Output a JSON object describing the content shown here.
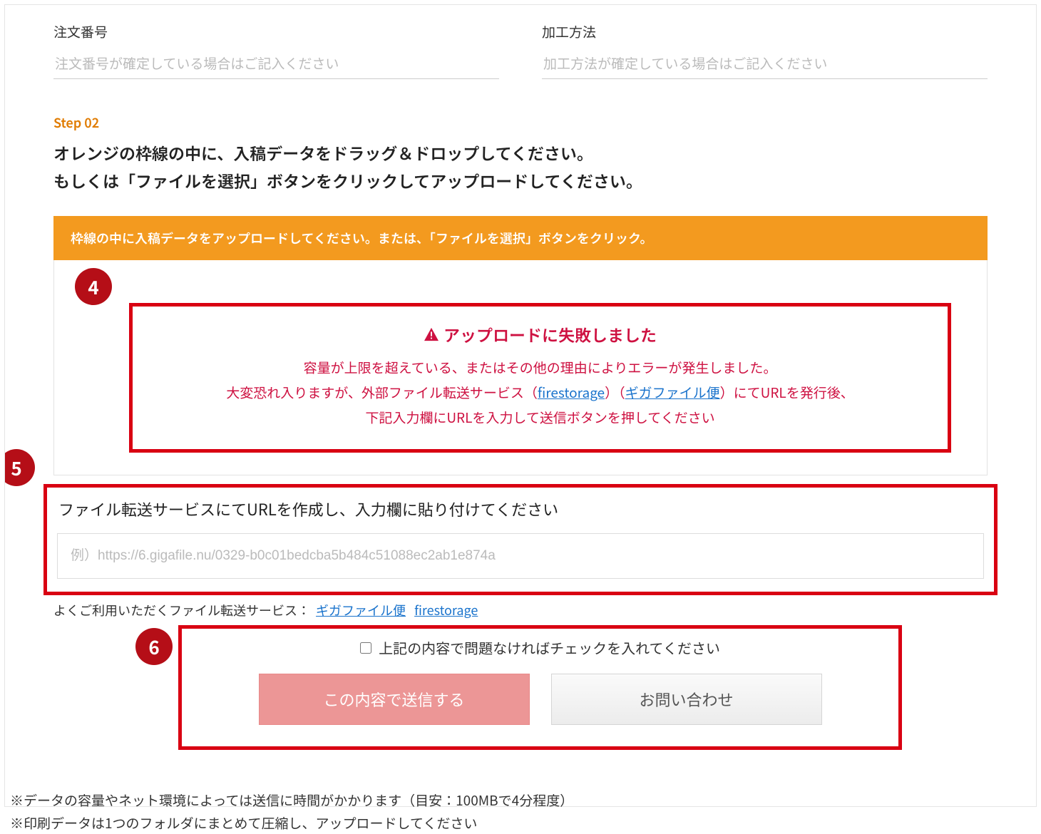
{
  "fields": {
    "order_number": {
      "label": "注文番号",
      "placeholder": "注文番号が確定している場合はご記入ください"
    },
    "process_method": {
      "label": "加工方法",
      "placeholder": "加工方法が確定している場合はご記入ください"
    }
  },
  "step02": {
    "label": "Step 02",
    "line1": "オレンジの枠線の中に、入稿データをドラッグ＆ドロップしてください。",
    "line2": "もしくは「ファイルを選択」ボタンをクリックしてアップロードしてください。"
  },
  "orange_bar": "枠線の中に入稿データをアップロードしてください。または、「ファイルを選択」ボタンをクリック。",
  "error": {
    "title": "アップロードに失敗しました",
    "line1": "容量が上限を超えている、またはその他の理由によりエラーが発生しました。",
    "line2_a": "大変恐れ入りますが、外部ファイル転送サービス（",
    "link1": "firestorage",
    "mid1": "）（",
    "link2": "ギガファイル便",
    "line2_b": "）にてURLを発行後、",
    "line3": "下記入力欄にURLを入力して送信ボタンを押してください"
  },
  "url_section": {
    "label": "ファイル転送サービスにてURLを作成し、入力欄に貼り付けてください",
    "placeholder": "例）https://6.gigafile.nu/0329-b0c01bedcba5b484c51088ec2ab1e874a"
  },
  "services": {
    "prefix": "よくご利用いただくファイル転送サービス：",
    "link1": "ギガファイル便",
    "link2": "firestorage"
  },
  "confirm": {
    "checkbox_label": "上記の内容で問題なければチェックを入れてください",
    "submit": "この内容で送信する",
    "inquiry": "お問い合わせ"
  },
  "footnotes": {
    "line1": "※データの容量やネット環境によっては送信に時間がかかります（目安：100MBで4分程度）",
    "line2": "※印刷データは1つのフォルダにまとめて圧縮し、アップロードしてください"
  },
  "badges": {
    "b4": "4",
    "b5": "5",
    "b6": "6"
  }
}
